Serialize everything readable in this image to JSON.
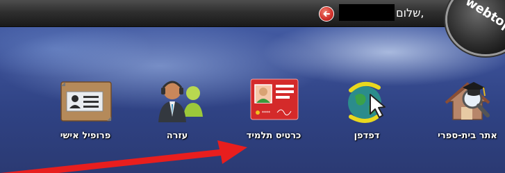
{
  "topbar": {
    "greeting": "שלום,",
    "logo_text": "webtop"
  },
  "apps": [
    {
      "label": "אתר בית-ספרי",
      "icon": "school-website-icon"
    },
    {
      "label": "דפדפן",
      "icon": "browser-globe-icon"
    },
    {
      "label": "כרטיס תלמיד",
      "icon": "student-card-icon"
    },
    {
      "label": "עזרה",
      "icon": "help-support-icon"
    },
    {
      "label": "פרופיל אישי",
      "icon": "personal-profile-icon"
    }
  ],
  "colors": {
    "topbar": "#2f2f2f",
    "annotation_arrow": "#e81e1e",
    "student_card": "#d42a2a"
  }
}
